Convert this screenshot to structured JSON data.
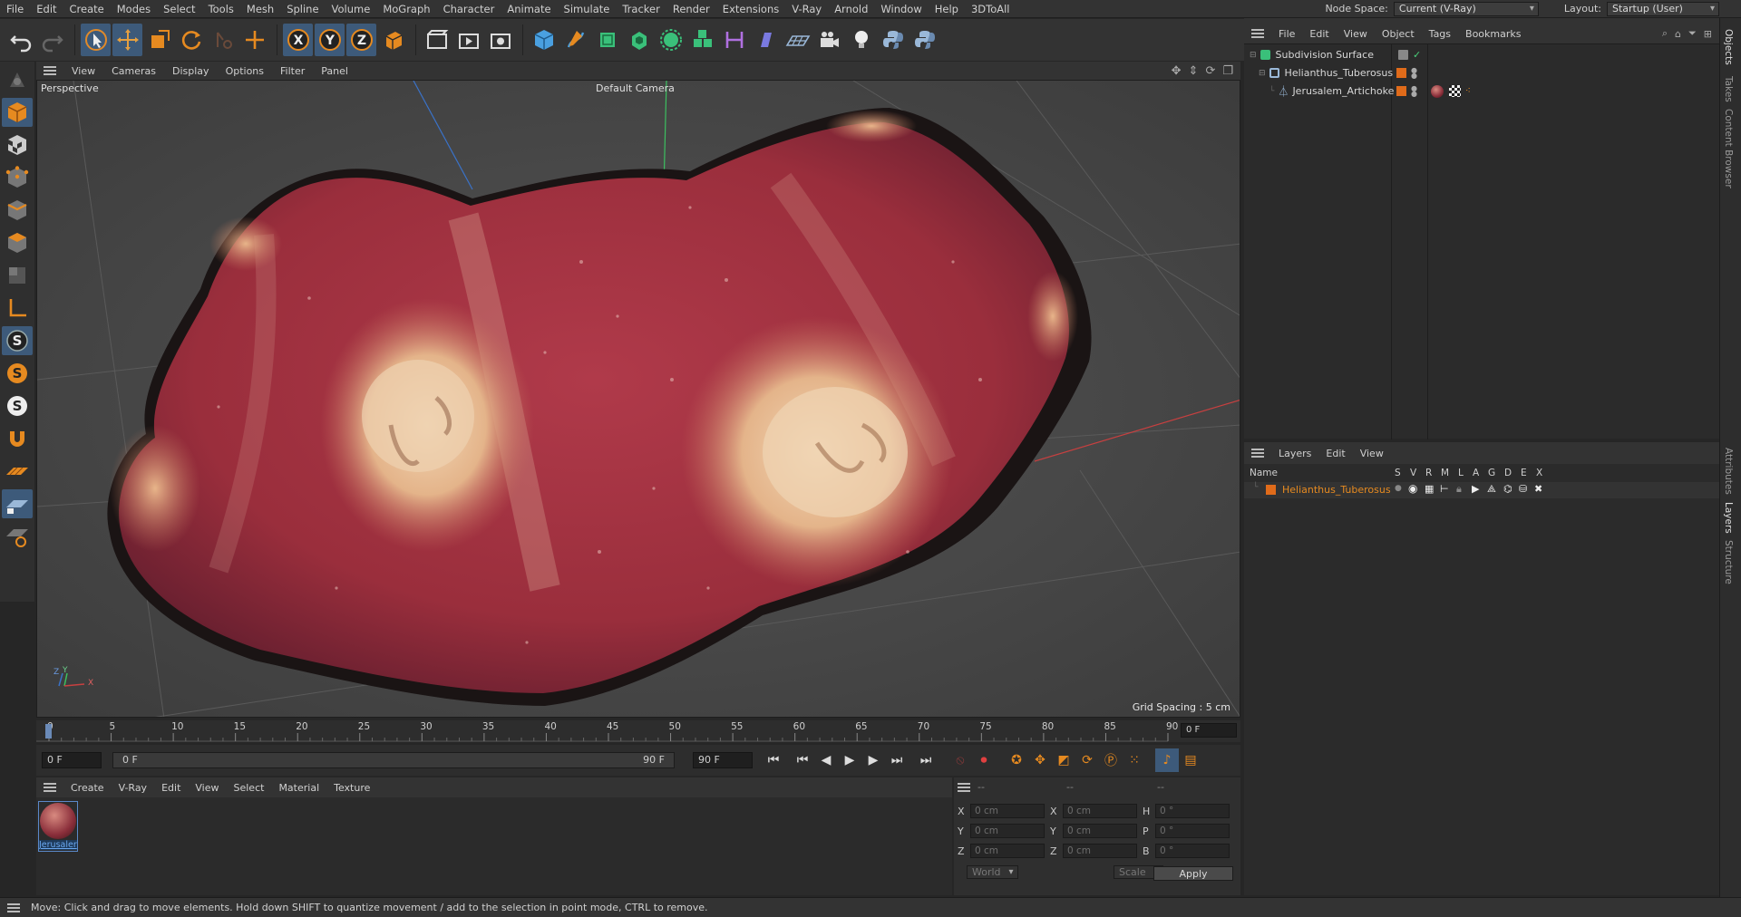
{
  "menubar": {
    "items": [
      "File",
      "Edit",
      "Create",
      "Modes",
      "Select",
      "Tools",
      "Mesh",
      "Spline",
      "Volume",
      "MoGraph",
      "Character",
      "Animate",
      "Simulate",
      "Tracker",
      "Render",
      "Extensions",
      "V-Ray",
      "Arnold",
      "Window",
      "Help",
      "3DToAll"
    ],
    "node_space_label": "Node Space:",
    "node_space_value": "Current (V-Ray)",
    "layout_label": "Layout:",
    "layout_value": "Startup (User)"
  },
  "viewport": {
    "menu": [
      "View",
      "Cameras",
      "Display",
      "Options",
      "Filter",
      "Panel"
    ],
    "projection": "Perspective",
    "camera": "Default Camera",
    "grid_spacing": "Grid Spacing : 5 cm",
    "axis_labels": {
      "x": "X",
      "y": "Y",
      "z": "Z"
    }
  },
  "timeline": {
    "ticks": [
      "0",
      "5",
      "10",
      "15",
      "20",
      "25",
      "30",
      "35",
      "40",
      "45",
      "50",
      "55",
      "60",
      "65",
      "70",
      "75",
      "80",
      "85",
      "90"
    ],
    "current_frame": "0 F",
    "start_frame": "0 F",
    "range_start": "0 F",
    "range_end": "90 F",
    "end_frame": "90 F"
  },
  "material_manager": {
    "menu": [
      "Create",
      "V-Ray",
      "Edit",
      "View",
      "Select",
      "Material",
      "Texture"
    ],
    "materials": [
      {
        "name": "Jerusaler"
      }
    ]
  },
  "coordinates": {
    "headers": [
      "--",
      "--",
      "--"
    ],
    "rows": [
      {
        "a_label": "X",
        "a_val": "0 cm",
        "b_label": "X",
        "b_val": "0 cm",
        "c_label": "H",
        "c_val": "0 °"
      },
      {
        "a_label": "Y",
        "a_val": "0 cm",
        "b_label": "Y",
        "b_val": "0 cm",
        "c_label": "P",
        "c_val": "0 °"
      },
      {
        "a_label": "Z",
        "a_val": "0 cm",
        "b_label": "Z",
        "b_val": "0 cm",
        "c_label": "B",
        "c_val": "0 °"
      }
    ],
    "mode_world": "World",
    "mode_scale": "Scale",
    "apply_label": "Apply"
  },
  "object_manager": {
    "menu": [
      "File",
      "Edit",
      "View",
      "Object",
      "Tags",
      "Bookmarks"
    ],
    "objects": [
      {
        "name": "Subdivision Surface"
      },
      {
        "name": "Helianthus_Tuberosus"
      },
      {
        "name": "Jerusalem_Artichoke"
      }
    ]
  },
  "layer_manager": {
    "menu": [
      "Layers",
      "Edit",
      "View"
    ],
    "columns": [
      "Name",
      "S",
      "V",
      "R",
      "M",
      "L",
      "A",
      "G",
      "D",
      "E",
      "X"
    ],
    "layers": [
      {
        "name": "Helianthus_Tuberosus"
      }
    ]
  },
  "side_tabs": [
    "Objects",
    "Takes",
    "Content Browser",
    "Attributes",
    "Layers",
    "Structure"
  ],
  "status": {
    "message": "Move: Click and drag to move elements. Hold down SHIFT to quantize movement / add to the selection in point mode, CTRL to remove."
  },
  "colors": {
    "accent": "#e06b1a",
    "selection": "#4a8fd8",
    "viewport_bg": "#4a4a4a"
  }
}
